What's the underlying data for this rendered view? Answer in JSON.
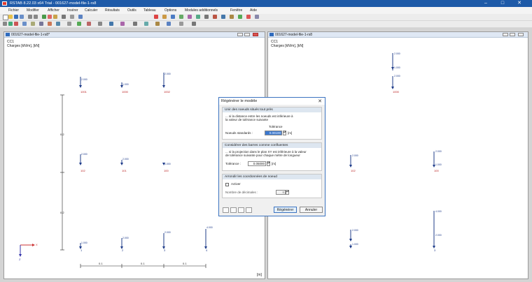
{
  "window": {
    "title": "RSTAB 8.22.03 x64 Trial - 001627-model-file-1-rs8"
  },
  "menu": [
    "Fichier",
    "Modifier",
    "Afficher",
    "Insérer",
    "Calculer",
    "Résultats",
    "Outils",
    "Tableau",
    "Options",
    "Modules additionnels",
    "Fenêtre",
    "Aide"
  ],
  "left_pane": {
    "title": "001627-model-file-1-rs8*",
    "case": "CC1",
    "load_label": "Charges [kN/m], [kN]",
    "loads": [
      "2.000",
      "1.000",
      "2.000",
      "2.000",
      "2.000",
      "1.000",
      "1.000",
      "2.000",
      "2.000",
      "4.000"
    ],
    "nodes": [
      "1001",
      "1000",
      "1002",
      "102",
      "101",
      "100",
      "1",
      "2",
      "3",
      "4"
    ],
    "dims": [
      "0.1",
      "0.1",
      "0.1"
    ],
    "vert_dims": [
      "0.2",
      "0.2"
    ],
    "axes": {
      "x": "X",
      "z": "Z"
    },
    "corner": "[m]"
  },
  "right_pane": {
    "title": "001627-model-file-1-rs8",
    "case": "CC1",
    "load_label": "Charges [kN/m], [kN]",
    "loads": [
      "2.000",
      "1.000",
      "2.000",
      "2.000",
      "2.000",
      "1.000",
      "4.000",
      "2.000",
      "1.000",
      "2.000"
    ],
    "nodes": [
      "1000",
      "102",
      "100",
      "3"
    ]
  },
  "dialog": {
    "title": "Régénérer le modèle",
    "sec1": {
      "header": "Unir des noeuds situés tout près",
      "desc1": "... si la distance entre les noeuds est inférieure à",
      "desc2": "la valeur de tolérance suivante",
      "tol_header": "Tolérance",
      "field_label": "Noeuds standards :",
      "field_value": "0.00100",
      "unit": "[m]"
    },
    "sec2": {
      "header": "Considérer des barres comme confluentes",
      "desc1": "... si la projection dans le plan XY est inférieure à la valeur",
      "desc2": "de tolérance suivante pour chaque mètre de longueur",
      "field_label": "Tolérance :",
      "field_value": "0.05000",
      "unit": "[m]"
    },
    "sec3": {
      "header": "Arrondir les coordonnées de noeud",
      "checkbox_label": "Activer",
      "decimals_label": "Nombre de décimales :",
      "decimals_value": "6"
    },
    "ok_label": "Régénérer",
    "cancel_label": "Annuler"
  }
}
